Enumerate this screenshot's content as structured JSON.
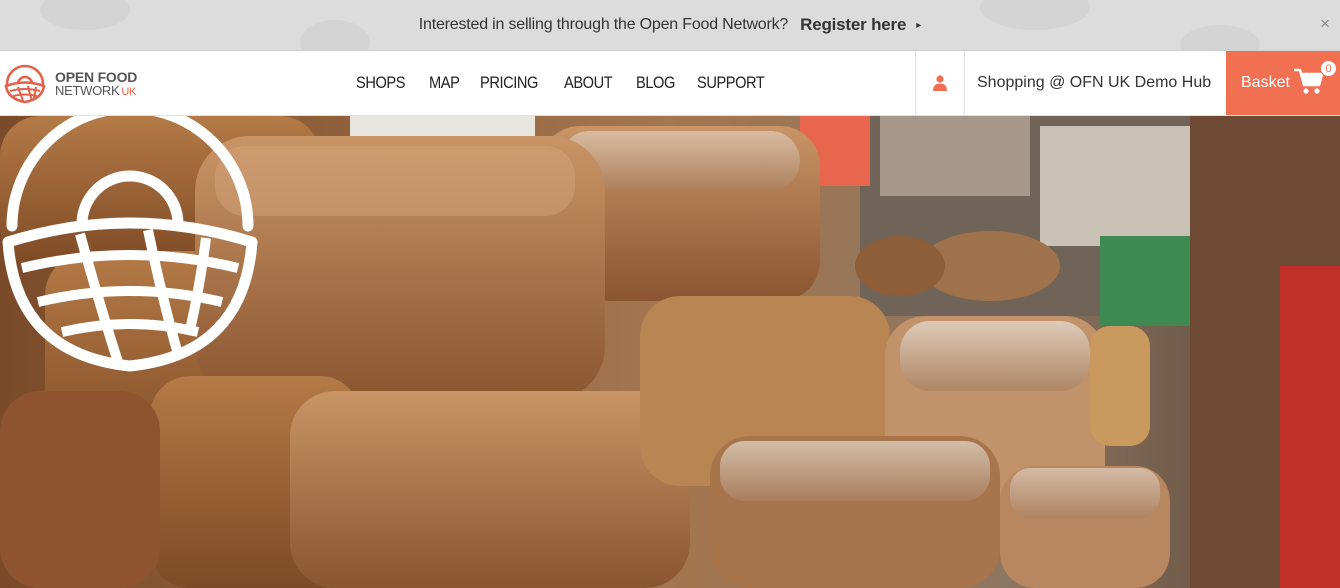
{
  "banner": {
    "text": "Interested in selling through the Open Food Network?",
    "link": "Register here",
    "caret": "▸",
    "close": "×"
  },
  "logo": {
    "line1": "OPEN FOOD",
    "line2": "NETWORK",
    "region": "UK"
  },
  "menu": {
    "items": [
      "SHOPS",
      "MAP",
      "PRICING",
      "ABOUT",
      "BLOG",
      "SUPPORT"
    ]
  },
  "account": {
    "icon": "user-icon"
  },
  "hub": {
    "label": "Shopping @ OFN UK Demo Hub"
  },
  "basket": {
    "label": "Basket",
    "count": "0",
    "icon": "cart-icon"
  },
  "colors": {
    "accent": "#f27052",
    "banner_bg": "#dcdcdc"
  }
}
